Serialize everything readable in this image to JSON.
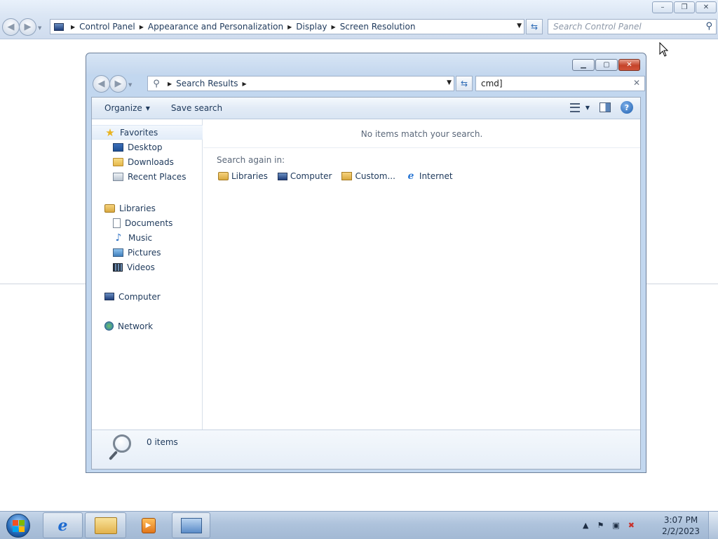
{
  "background_window": {
    "breadcrumb": [
      "Control Panel",
      "Appearance and Personalization",
      "Display",
      "Screen Resolution"
    ],
    "search_placeholder": "Search Control Panel",
    "caption_buttons": {
      "minimize": "–",
      "restore": "❐",
      "close": "✕"
    }
  },
  "search_window": {
    "breadcrumb": [
      "Search Results"
    ],
    "search_value": "cmd]",
    "toolbar": {
      "organize_label": "Organize",
      "save_search_label": "Save search"
    },
    "nav_pane": {
      "favorites": {
        "label": "Favorites",
        "items": [
          "Desktop",
          "Downloads",
          "Recent Places"
        ]
      },
      "libraries": {
        "label": "Libraries",
        "items": [
          "Documents",
          "Music",
          "Pictures",
          "Videos"
        ]
      },
      "computer": {
        "label": "Computer"
      },
      "network": {
        "label": "Network"
      }
    },
    "content": {
      "no_items_message": "No items match your search.",
      "search_again_label": "Search again in:",
      "search_again_items": [
        "Libraries",
        "Computer",
        "Custom...",
        "Internet"
      ]
    },
    "details": {
      "item_count": "0 items"
    }
  },
  "taskbar": {
    "clock_time": "3:07 PM",
    "clock_date": "2/2/2023"
  },
  "colors": {
    "accent": "#1e395b",
    "window_frame": "#c2d7ef",
    "close_button": "#c5432a"
  }
}
